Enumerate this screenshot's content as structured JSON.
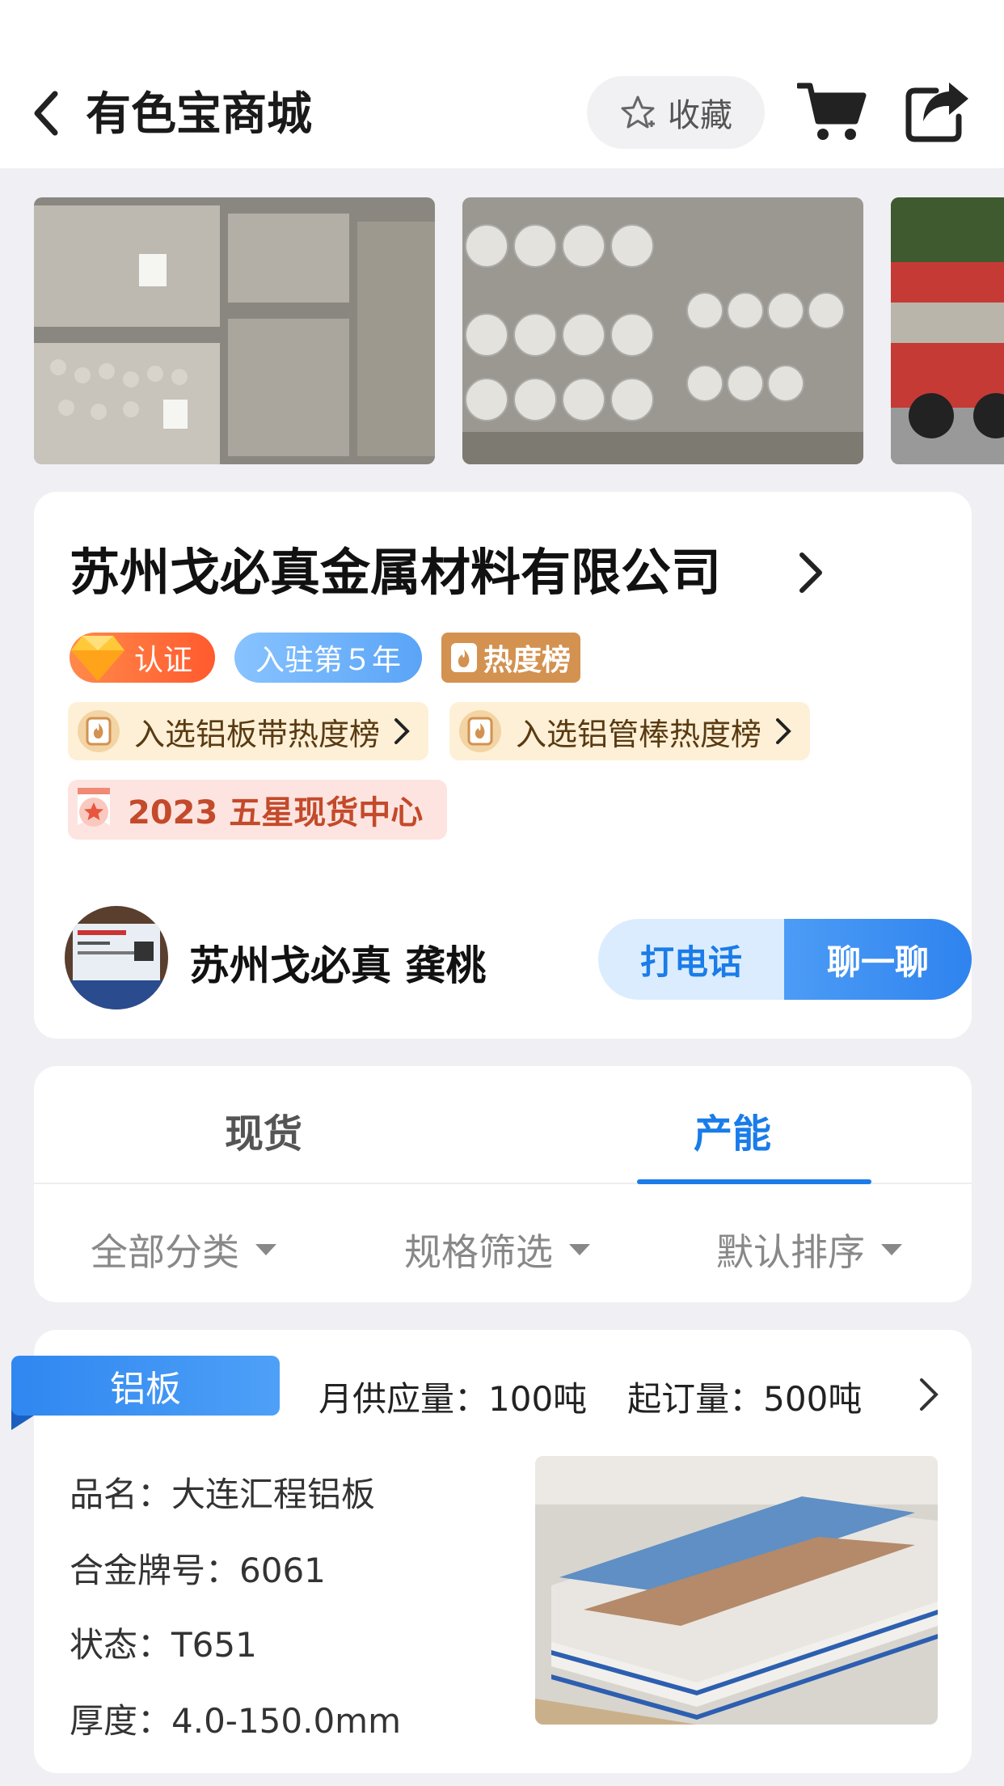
{
  "header": {
    "title": "有色宝商城",
    "favorite_label": "收藏"
  },
  "company": {
    "name": "苏州戈必真金属材料有限公司",
    "cert_badge": "认证",
    "years_badge": "入驻第５年",
    "hot_badge": "热度榜",
    "rank_1": "入选铝板带热度榜",
    "rank_2": "入选铝管棒热度榜",
    "star_badge": "2023 五星现货中心",
    "contact_name": "苏州戈必真 龚桃",
    "call_label": "打电话",
    "chat_label": "聊一聊"
  },
  "tabs": {
    "stock": "现货",
    "capacity": "产能",
    "active": "产能"
  },
  "filters": {
    "category": "全部分类",
    "spec": "规格筛选",
    "sort": "默认排序"
  },
  "product": {
    "category_tag": "铝板",
    "monthly_supply": "月供应量：100吨",
    "min_order": "起订量：500吨",
    "name": "品名：大连汇程铝板",
    "alloy": "合金牌号：6061",
    "temper": "状态：T651",
    "thickness": "厚度：4.0-150.0mm"
  },
  "colors": {
    "accent": "#1a7ce8",
    "cert": "#ff5a2e",
    "years": "#5aa4f7",
    "hot": "#d39250"
  }
}
